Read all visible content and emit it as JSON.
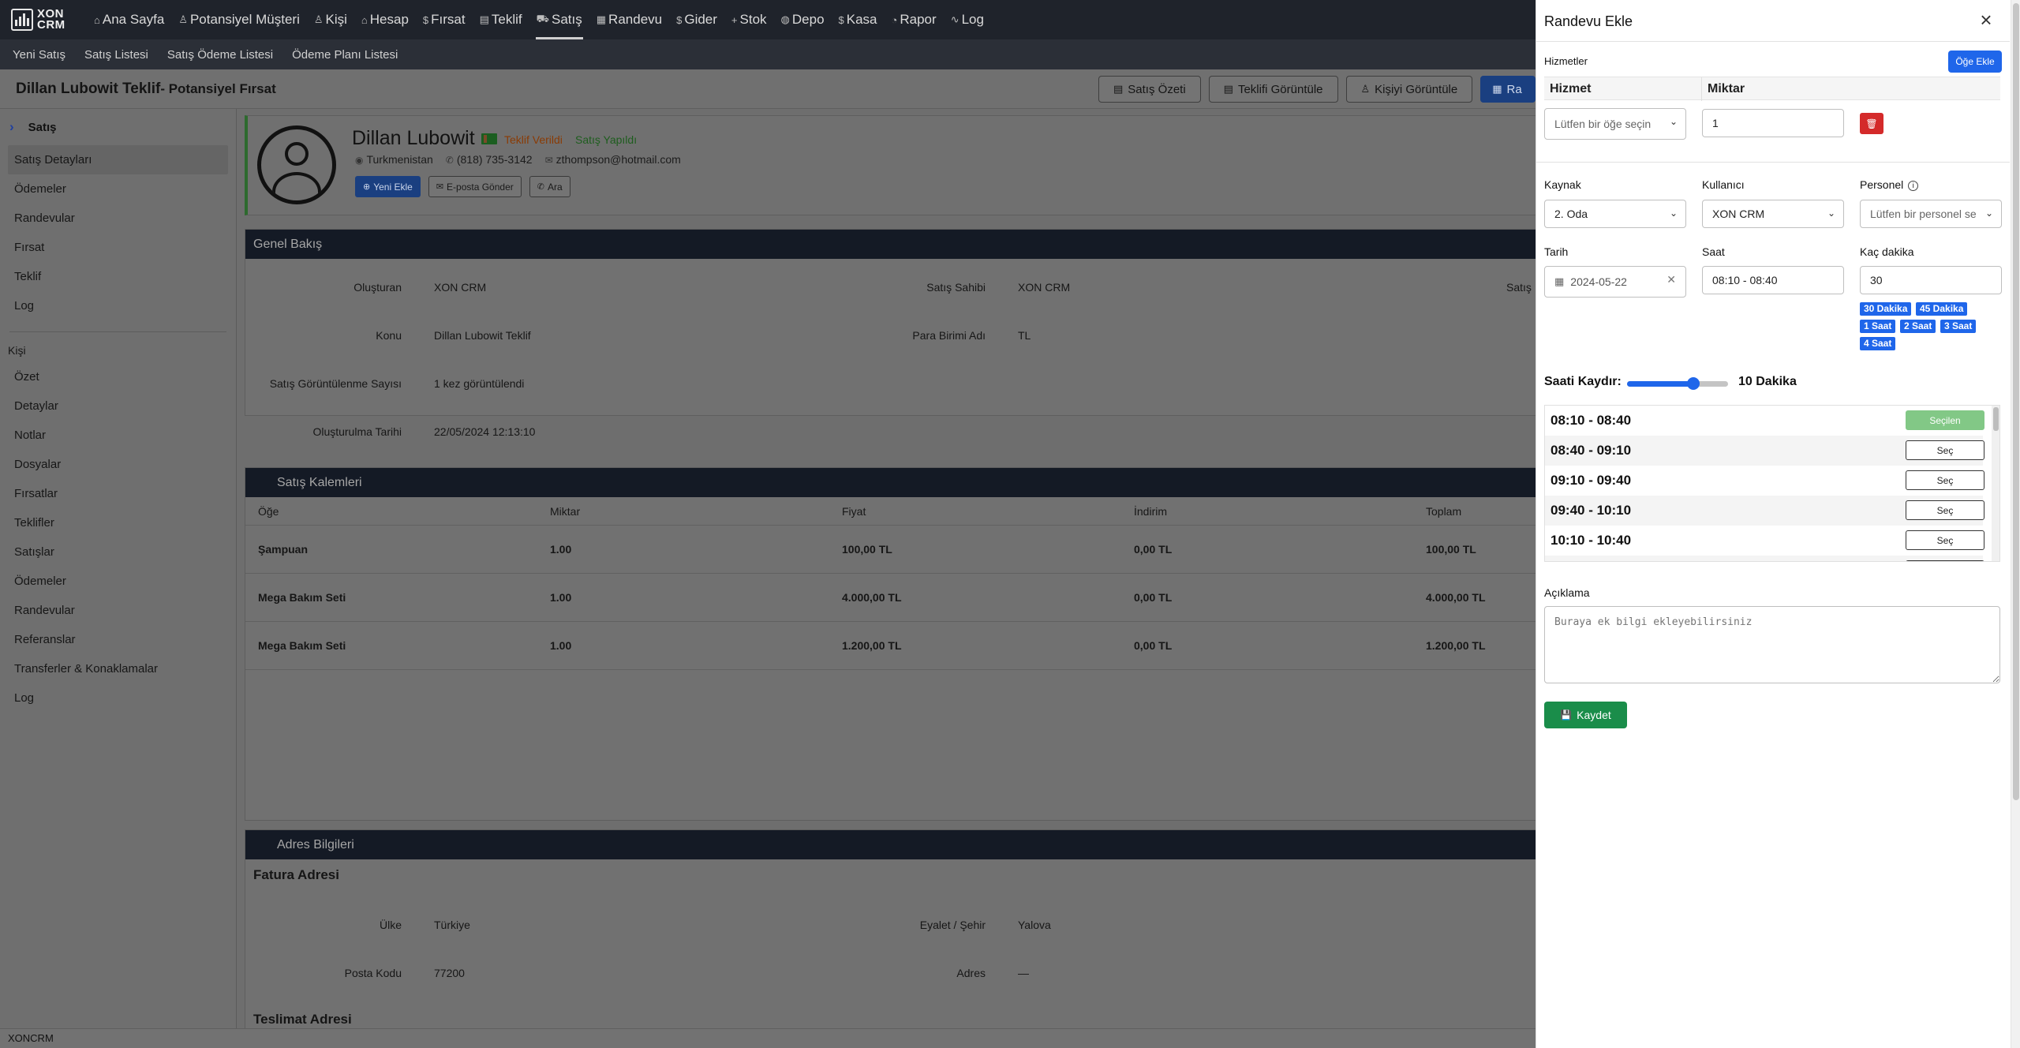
{
  "app": {
    "logo_line1": "XON",
    "logo_line2": "CRM"
  },
  "nav": {
    "items": [
      {
        "label": "Ana Sayfa",
        "icon": "⌂"
      },
      {
        "label": "Potansiyel Müşteri",
        "icon": "♙"
      },
      {
        "label": "Kişi",
        "icon": "♙"
      },
      {
        "label": "Hesap",
        "icon": "⌂"
      },
      {
        "label": "Fırsat",
        "icon": "$"
      },
      {
        "label": "Teklif",
        "icon": "▤"
      },
      {
        "label": "Satış",
        "icon": "⛟"
      },
      {
        "label": "Randevu",
        "icon": "▦"
      },
      {
        "label": "Gider",
        "icon": "$"
      },
      {
        "label": "Stok",
        "icon": "+"
      },
      {
        "label": "Depo",
        "icon": "◍"
      },
      {
        "label": "Kasa",
        "icon": "$"
      },
      {
        "label": "Rapor",
        "icon": "◔"
      },
      {
        "label": "Log",
        "icon": "∿"
      }
    ],
    "active_index": 6
  },
  "subnav": {
    "items": [
      "Yeni Satış",
      "Satış Listesi",
      "Satış Ödeme Listesi",
      "Ödeme Planı Listesi"
    ]
  },
  "header": {
    "title": "Dillan Lubowit Teklif",
    "subtitle": "- Potansiyel Fırsat",
    "buttons": [
      "Satış Özeti",
      "Teklifi Görüntüle",
      "Kişiyi Görüntüle",
      "Ra"
    ]
  },
  "sidebar": {
    "head": "Satış",
    "sale_items": [
      "Satış Detayları",
      "Ödemeler",
      "Randevular",
      "Fırsat",
      "Teklif",
      "Log"
    ],
    "section": "Kişi",
    "person_items": [
      "Özet",
      "Detaylar",
      "Notlar",
      "Dosyalar",
      "Fırsatlar",
      "Teklifler",
      "Satışlar",
      "Ödemeler",
      "Randevular",
      "Referanslar",
      "Transferler & Konaklamalar",
      "Log"
    ]
  },
  "profile": {
    "name": "Dillan Lubowit",
    "badge_offer": "Teklif Verildi",
    "badge_sale": "Satış Yapıldı",
    "country": "Turkmenistan",
    "phone": "(818) 735-3142",
    "email": "zthompson@hotmail.com",
    "btn_new": "Yeni Ekle",
    "btn_email": "E-posta Gönder",
    "btn_call": "Ara"
  },
  "overview": {
    "title": "Genel Bakış",
    "created_by_label": "Oluşturan",
    "created_by": "XON CRM",
    "owner_label": "Satış Sahibi",
    "owner": "XON CRM",
    "cut_label": "Satış",
    "subject_label": "Konu",
    "subject": "Dillan Lubowit Teklif",
    "currency_label": "Para Birimi Adı",
    "currency": "TL",
    "views_label": "Satış Görüntülenme Sayısı",
    "views": "1 kez görüntülendi",
    "created_at_label": "Oluşturulma Tarihi",
    "created_at": "22/05/2024 12:13:10"
  },
  "items": {
    "title": "Satış Kalemleri",
    "columns": [
      "Öğe",
      "Miktar",
      "Fiyat",
      "İndirim",
      "Toplam"
    ],
    "rows": [
      [
        "Şampuan",
        "1.00",
        "100,00 TL",
        "0,00 TL",
        "100,00 TL"
      ],
      [
        "Mega Bakım Seti",
        "1.00",
        "4.000,00 TL",
        "0,00 TL",
        "4.000,00 TL"
      ],
      [
        "Mega Bakım Seti",
        "1.00",
        "1.200,00 TL",
        "0,00 TL",
        "1.200,00 TL"
      ]
    ]
  },
  "address": {
    "title": "Adres Bilgileri",
    "billing_title": "Fatura Adresi",
    "country_label": "Ülke",
    "country": "Türkiye",
    "state_label": "Eyalet / Şehir",
    "state": "Yalova",
    "zip_label": "Posta Kodu",
    "zip": "77200",
    "addr_label": "Adres",
    "addr": "—",
    "shipping_title": "Teslimat Adresi"
  },
  "footer": {
    "text": "XONCRM"
  },
  "drawer": {
    "title": "Randevu Ekle",
    "services_label": "Hizmetler",
    "add_item": "Öğe Ekle",
    "col_service": "Hizmet",
    "col_qty": "Miktar",
    "service_placeholder": "Lütfen bir öğe seçin",
    "qty_value": "1",
    "source_label": "Kaynak",
    "source_value": "2. Oda",
    "user_label": "Kullanıcı",
    "user_value": "XON CRM",
    "staff_label": "Personel",
    "staff_placeholder": "Lütfen bir personel se",
    "date_label": "Tarih",
    "date_value": "2024-05-22",
    "time_label": "Saat",
    "time_value": "08:10 - 08:40",
    "minutes_label": "Kaç dakika",
    "minutes_value": "30",
    "chips": [
      "30 Dakika",
      "45 Dakika",
      "1 Saat",
      "2 Saat",
      "3 Saat",
      "4 Saat"
    ],
    "shift_label": "Saati Kaydır:",
    "shift_value": "10 Dakika",
    "shift_fraction": 0.66,
    "slots": [
      {
        "time": "08:10 - 08:40",
        "action": "Seçilen",
        "selected": true
      },
      {
        "time": "08:40 - 09:10",
        "action": "Seç",
        "selected": false
      },
      {
        "time": "09:10 - 09:40",
        "action": "Seç",
        "selected": false
      },
      {
        "time": "09:40 - 10:10",
        "action": "Seç",
        "selected": false
      },
      {
        "time": "10:10 - 10:40",
        "action": "Seç",
        "selected": false
      }
    ],
    "note_label": "Açıklama",
    "note_placeholder": "Buraya ek bilgi ekleyebilirsiniz",
    "save": "Kaydet"
  }
}
